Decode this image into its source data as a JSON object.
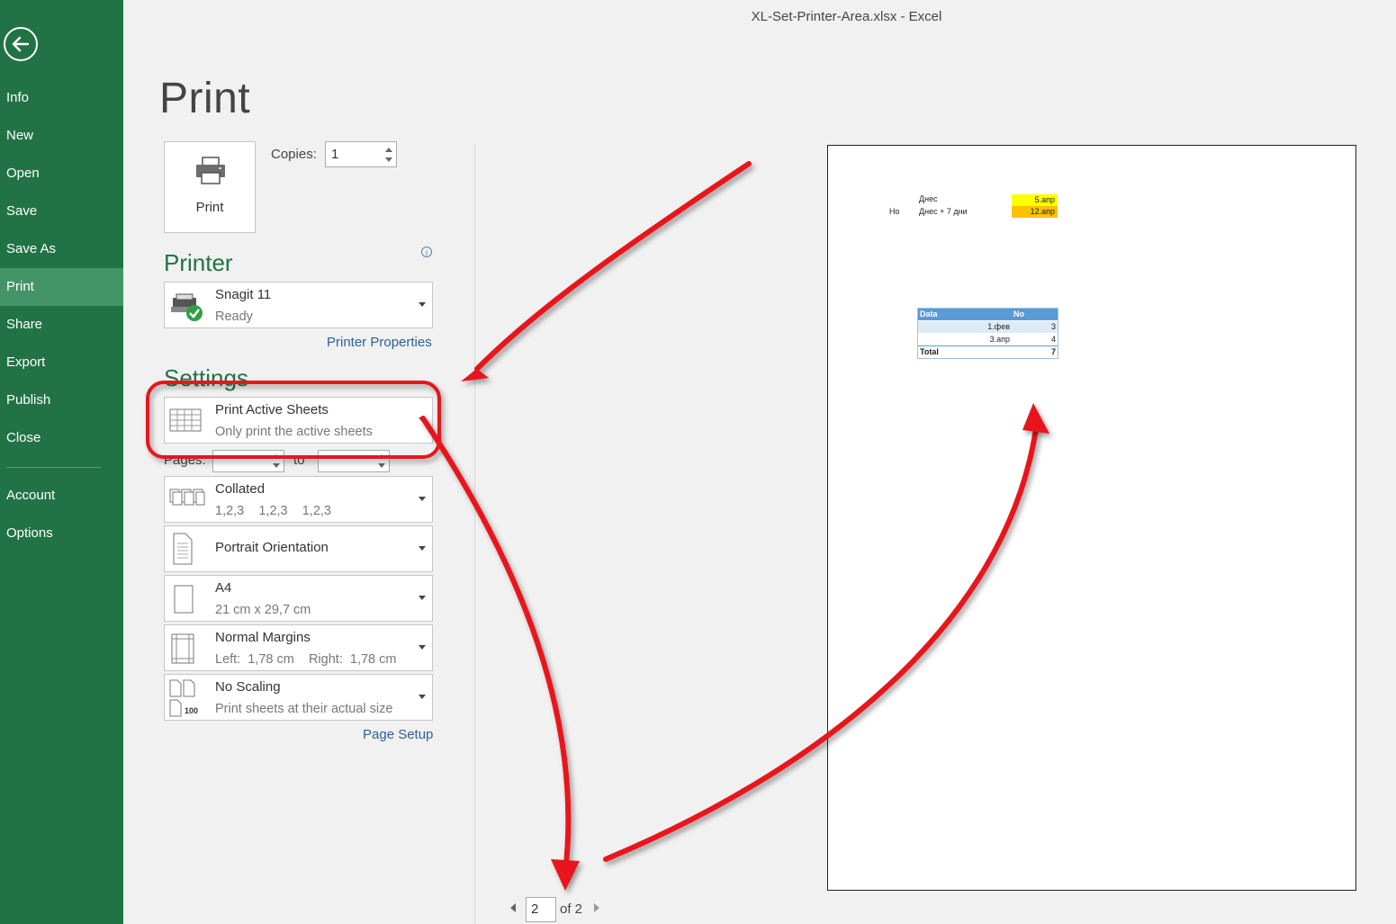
{
  "window": {
    "title": "XL-Set-Printer-Area.xlsx - Excel"
  },
  "sidebar": {
    "items": [
      {
        "label": "Info"
      },
      {
        "label": "New"
      },
      {
        "label": "Open"
      },
      {
        "label": "Save"
      },
      {
        "label": "Save As"
      },
      {
        "label": "Print",
        "active": true
      },
      {
        "label": "Share"
      },
      {
        "label": "Export"
      },
      {
        "label": "Publish"
      },
      {
        "label": "Close"
      },
      {
        "label": "Account"
      },
      {
        "label": "Options"
      }
    ]
  },
  "print": {
    "title": "Print",
    "button_label": "Print",
    "copies_label": "Copies:",
    "copies_value": "1"
  },
  "printer": {
    "heading": "Printer",
    "name": "Snagit 11",
    "status": "Ready",
    "properties_link": "Printer Properties",
    "info_glyph": "i"
  },
  "settings": {
    "heading": "Settings",
    "what": {
      "title": "Print Active Sheets",
      "subtitle": "Only print the active sheets"
    },
    "pages_label": "Pages:",
    "to_label": "to",
    "collation": {
      "title": "Collated",
      "subtitle": "1,2,3    1,2,3    1,2,3"
    },
    "orientation": {
      "title": "Portrait Orientation"
    },
    "paper": {
      "title": "A4",
      "subtitle": "21 cm x 29,7 cm"
    },
    "margins": {
      "title": "Normal Margins",
      "subtitle": "Left:  1,78 cm    Right:  1,78 cm"
    },
    "scaling": {
      "title": "No Scaling",
      "subtitle": "Print sheets at their actual size",
      "icon_text": "100"
    },
    "page_setup_link": "Page Setup"
  },
  "preview": {
    "row1_label": "Днес",
    "row1_value": "5.апр",
    "row2_prefix": "Но",
    "row2_label": "Днес + 7 дни",
    "row2_value": "12.апр",
    "table_headers": [
      "Data",
      "No"
    ],
    "table_rows": [
      {
        "date": "1.фев",
        "no": "3"
      },
      {
        "date": "3.апр",
        "no": "4"
      }
    ],
    "total_label": "Total",
    "total_value": "7"
  },
  "pager": {
    "current": "2",
    "of_label": "of 2"
  },
  "colors": {
    "excel_green": "#217346",
    "active_nav": "#439467",
    "annotation_red": "#e8141b"
  }
}
